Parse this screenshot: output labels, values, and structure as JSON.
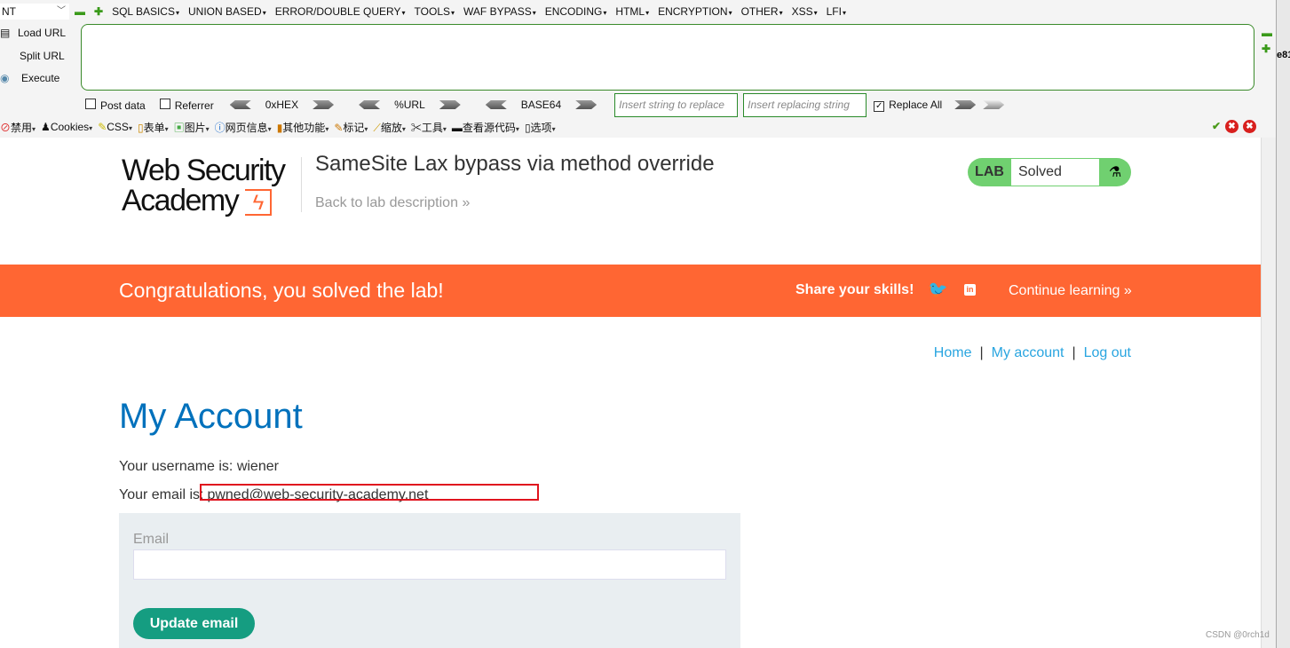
{
  "hackbar": {
    "select_value": "NT",
    "menus": [
      "SQL BASICS",
      "UNION BASED",
      "ERROR/DOUBLE QUERY",
      "TOOLS",
      "WAF BYPASS",
      "ENCODING",
      "HTML",
      "ENCRYPTION",
      "OTHER",
      "XSS",
      "LFI"
    ],
    "load_url": "Load URL",
    "split_url": "Split URL",
    "execute": "Execute",
    "url_value": "",
    "post_data": "Post data",
    "referrer": "Referrer",
    "hex": "0xHEX",
    "url_enc": "%URL",
    "base64": "BASE64",
    "replace_placeholder": "Insert string to replace",
    "replacing_placeholder": "Insert replacing string",
    "replace_all": "Replace All",
    "replace_all_checked": true
  },
  "webdev_toolbar": {
    "items": [
      "禁用",
      "Cookies",
      "CSS",
      "表单",
      "图片",
      "网页信息",
      "其他功能",
      "标记",
      "缩放",
      "工具",
      "查看源代码",
      "选项"
    ]
  },
  "side_text": "e81",
  "header": {
    "logo": "Web Security Academy",
    "title": "SameSite Lax bypass via method override",
    "back_link": "Back to lab description",
    "lab_label": "LAB",
    "lab_status": "Solved"
  },
  "banner": {
    "message": "Congratulations, you solved the lab!",
    "share": "Share your skills!",
    "continue": "Continue learning"
  },
  "nav": {
    "home": "Home",
    "account": "My account",
    "logout": "Log out",
    "sep": "|"
  },
  "main": {
    "heading": "My Account",
    "username_text": "Your username is: wiener",
    "email_prefix": "Your email is:",
    "email": "pwned@web-security-academy.net",
    "email_label": "Email",
    "email_value": "",
    "update_button": "Update email"
  },
  "colors": {
    "orange": "#ff6633",
    "link": "#29a5e0",
    "heading": "#0071bc",
    "button": "#159d81",
    "lab_green": "#70d070"
  },
  "watermark": "CSDN @0rch1d"
}
